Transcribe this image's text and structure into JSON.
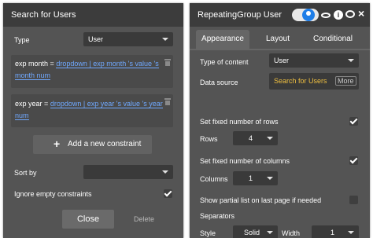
{
  "search_panel": {
    "title": "Search for Users",
    "type_label": "Type",
    "type_value": "User",
    "constraints": [
      {
        "key": "exp month",
        "operator": "=",
        "expression": [
          "dropdown",
          "|",
          "exp month",
          "'s value",
          "'s",
          "month num"
        ]
      },
      {
        "key": "exp year",
        "operator": "=",
        "expression": [
          "dropdown",
          "|",
          "exp year",
          "'s value",
          "'s year",
          "num"
        ]
      }
    ],
    "add_constraint_label": "Add a new constraint",
    "add_icon": "+",
    "sort_label": "Sort by",
    "sort_value": "",
    "ignore_empty_label": "Ignore empty constraints",
    "ignore_empty_checked": true,
    "close_label": "Close",
    "delete_label": "Delete"
  },
  "rg_panel": {
    "title": "RepeatingGroup User",
    "tabs": [
      "Appearance",
      "Layout",
      "Conditional"
    ],
    "active_tab": "Appearance",
    "type_label": "Type of content",
    "type_value": "User",
    "data_source_label": "Data source",
    "data_source_expr": "Search for Users",
    "more_label": "More",
    "fixed_rows_label": "Set fixed number of rows",
    "fixed_rows_checked": true,
    "rows_label": "Rows",
    "rows_value": "4",
    "fixed_cols_label": "Set fixed number of columns",
    "fixed_cols_checked": true,
    "columns_label": "Columns",
    "columns_value": "1",
    "partial_list_label": "Show partial list on last page if needed",
    "partial_list_checked": false,
    "separators_label": "Separators",
    "style_label": "Style",
    "style_value": "Solid",
    "width_label": "Width",
    "width_value": "1",
    "header_icons": [
      "info-icon",
      "comment-icon",
      "close-icon"
    ]
  },
  "colors": {
    "panel_bg": "#545454",
    "header_bg": "#3c3c3c",
    "field_bg": "#3a3a3a",
    "dynamic_blue": "#6fa8ff",
    "expr_yellow": "#f0c040",
    "toggle_blue": "#1e7ee8"
  }
}
